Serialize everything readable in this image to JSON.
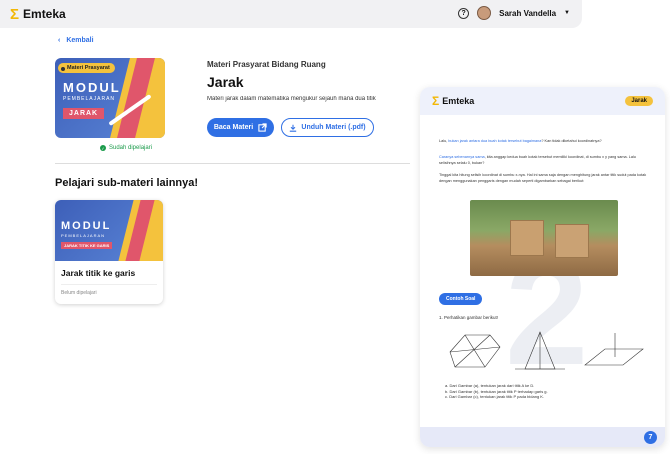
{
  "app": {
    "logo_text": "Emteka",
    "user_name": "Sarah Vandella"
  },
  "nav": {
    "back_label": "Kembali"
  },
  "material": {
    "cover_chip": "Materi Prasyarat",
    "cover_modul": "MODUL",
    "cover_pembelajaran": "PEMBELAJARAN",
    "cover_tag": "JARAK",
    "learned_status": "Sudah dipelajari",
    "category": "Materi Prasyarat Bidang Ruang",
    "title": "Jarak",
    "description": "Materi jarak dalam matematika mengukur sejauh mana dua titik",
    "read_button": "Baca Materi",
    "download_button": "Unduh Materi (.pdf)"
  },
  "sub_section": {
    "heading": "Pelajari sub-materi lainnya!",
    "cards": [
      {
        "cover_modul": "MODUL",
        "cover_pembelajaran": "PEMBELAJARAN",
        "cover_tag": "JARAK TITIK KE GARIS",
        "name": "Jarak titik ke garis",
        "status": "Belum dipelajari"
      }
    ]
  },
  "document": {
    "logo_text": "Emteka",
    "tag": "Jarak",
    "watermark": "2",
    "para1_a": "Lalu, ",
    "para1_hl": "bukan jarak antara dua buah kotak tersebut bagaimana",
    "para1_b": "? Kan tidak diketahui koordinatnya?",
    "para2_hl": "Caranya sebenarnya sama",
    "para2_b": ", kita anggap kedua buah kotak tersebut memiliki koordinat, di sumbu x y yang sama. Lalu selisihnya selalu 0, bukan?",
    "para3": "Tinggal kita hitung selisih koordinat di sumbu x-nya. Hal ini sama saja dengan menghitung jarak antar titik sudut pada kotak dengan menggunakan penggaris dengan mudah seperti digambarkan sebagai berikut:",
    "example_label": "Contoh Soal",
    "question": "1. Perhatikan gambar berikut!",
    "answers": [
      "a. Dari Gambar (a), tentukan jarak dari titik A ke D.",
      "b. Dari Gambar (b), tentukan jarak titik P terhadap garis g.",
      "c. Dari Gambar (c), tentukan jarak titik P pada bidang K."
    ],
    "page_number": "7"
  }
}
